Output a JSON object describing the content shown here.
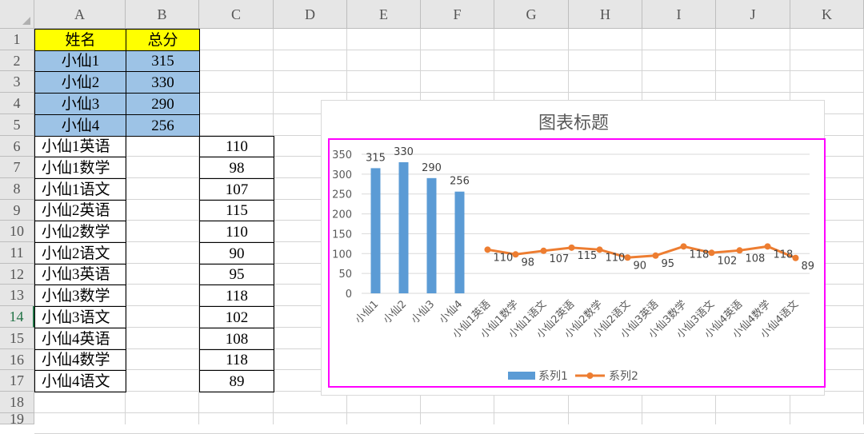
{
  "sheet": {
    "columns": [
      "A",
      "B",
      "C",
      "D",
      "E",
      "F",
      "G",
      "H",
      "I",
      "J",
      "K"
    ],
    "rows": [
      "1",
      "2",
      "3",
      "4",
      "5",
      "6",
      "7",
      "8",
      "9",
      "10",
      "11",
      "12",
      "13",
      "14",
      "15",
      "16",
      "17",
      "18",
      "19"
    ],
    "selected_row": "14",
    "header_row": [
      "姓名",
      "总分"
    ],
    "summary": [
      {
        "name": "小仙1",
        "total": "315"
      },
      {
        "name": "小仙2",
        "total": "330"
      },
      {
        "name": "小仙3",
        "total": "290"
      },
      {
        "name": "小仙4",
        "total": "256"
      }
    ],
    "details": [
      {
        "label": "小仙1英语",
        "score": "110"
      },
      {
        "label": "小仙1数学",
        "score": "98"
      },
      {
        "label": "小仙1语文",
        "score": "107"
      },
      {
        "label": "小仙2英语",
        "score": "115"
      },
      {
        "label": "小仙2数学",
        "score": "110"
      },
      {
        "label": "小仙2语文",
        "score": "90"
      },
      {
        "label": "小仙3英语",
        "score": "95"
      },
      {
        "label": "小仙3数学",
        "score": "118"
      },
      {
        "label": "小仙3语文",
        "score": "102"
      },
      {
        "label": "小仙4英语",
        "score": "108"
      },
      {
        "label": "小仙4数学",
        "score": "118"
      },
      {
        "label": "小仙4语文",
        "score": "89"
      }
    ]
  },
  "colors": {
    "bar": "#5b9bd5",
    "line": "#ed7d31",
    "selection_border": "#ff00ff",
    "header_yellow": "#ffff00",
    "header_blue": "#9dc3e6"
  },
  "chart_data": {
    "type": "bar",
    "title": "图表标题",
    "categories": [
      "小仙1",
      "小仙2",
      "小仙3",
      "小仙4",
      "小仙1英语",
      "小仙1数学",
      "小仙1语文",
      "小仙2英语",
      "小仙2数学",
      "小仙2语文",
      "小仙3英语",
      "小仙3数学",
      "小仙3语文",
      "小仙4英语",
      "小仙4数学",
      "小仙4语文"
    ],
    "series": [
      {
        "name": "系列1",
        "type": "bar",
        "values": [
          315,
          330,
          290,
          256,
          null,
          null,
          null,
          null,
          null,
          null,
          null,
          null,
          null,
          null,
          null,
          null
        ]
      },
      {
        "name": "系列2",
        "type": "line",
        "values": [
          null,
          null,
          null,
          null,
          110,
          98,
          107,
          115,
          110,
          90,
          95,
          118,
          102,
          108,
          118,
          89
        ]
      }
    ],
    "ylim": [
      0,
      350
    ],
    "yticks": [
      0,
      50,
      100,
      150,
      200,
      250,
      300,
      350
    ],
    "xlabel": "",
    "ylabel": "",
    "grid": true,
    "legend": "bottom"
  }
}
